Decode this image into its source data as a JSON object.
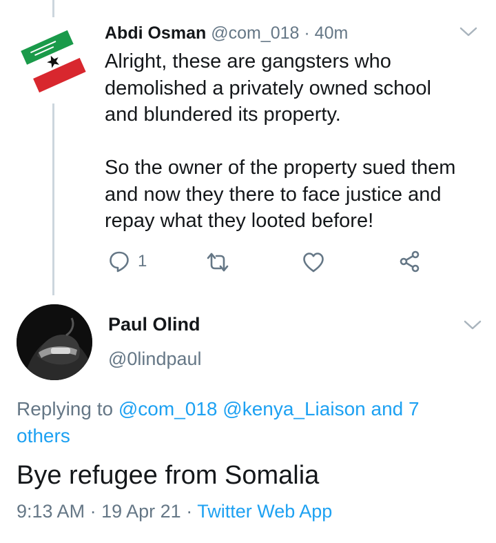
{
  "tweet1": {
    "author_name": "Abdi Osman",
    "handle": "@com_018",
    "separator": "·",
    "time": "40m",
    "text": "Alright, these are gangsters who\ndemolished a privately owned school\nand blundered its property.\n\nSo the owner of the property sued them\nand now they there to face justice and\nrepay what they looted before!",
    "reply_count": "1",
    "avatar_icon": "somaliland-flag-icon"
  },
  "tweet2": {
    "author_name": "Paul Olind",
    "handle": "@0lindpaul",
    "replying_prefix": "Replying to",
    "replying_mention1": "@com_018",
    "replying_mention2": "@kenya_Liaison",
    "replying_others": "and 7 others",
    "text": "Bye refugee from Somalia",
    "time": "9:13 AM",
    "separator1": "·",
    "date": "19 Apr 21",
    "separator2": "·",
    "source": "Twitter Web App"
  },
  "colors": {
    "link": "#1da1f2",
    "muted": "#657786",
    "text": "#14171a",
    "thread_line": "#ccd6dd"
  }
}
